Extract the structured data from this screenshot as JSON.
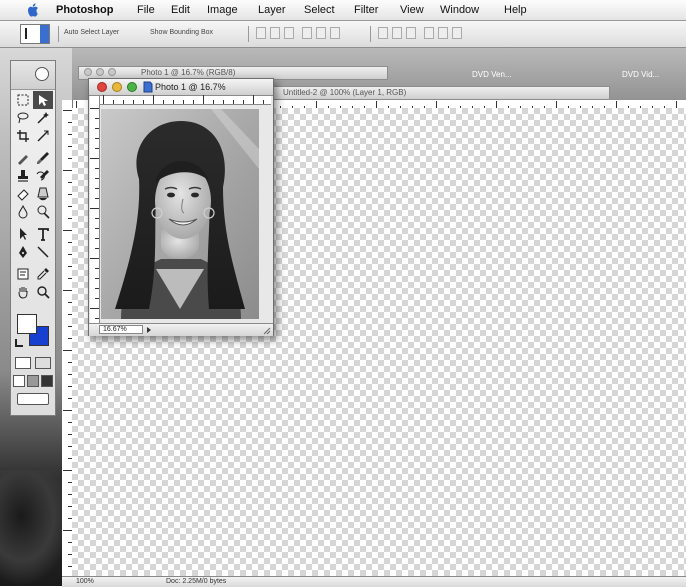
{
  "menubar": {
    "items": [
      "Photoshop",
      "File",
      "Edit",
      "Image",
      "Layer",
      "Select",
      "Filter",
      "View",
      "Window",
      "Help"
    ]
  },
  "options_bar": {
    "auto_select_layer": "Auto Select Layer",
    "show_bounding_box": "Show Bounding Box"
  },
  "desktop": {
    "labels": [
      "DVD Ven...",
      "DVD Vid..."
    ]
  },
  "background_windows": [
    {
      "title": "Photo 1 @ 16.7% (RGB/8)"
    },
    {
      "title": "Untitled-2 @ 100% (Layer 1, RGB)"
    }
  ],
  "photo_window": {
    "title": "Photo 1 @ 16.7%",
    "zoom": "16.67%"
  },
  "status_bar": {
    "zoom": "100%",
    "info": "Doc: 2.25M/0 bytes"
  },
  "colors": {
    "foreground": "#ffffff",
    "background": "#1840d0",
    "close_button": "#e0443e",
    "minimize_button": "#e8b83a",
    "zoom_button": "#4cb447"
  }
}
